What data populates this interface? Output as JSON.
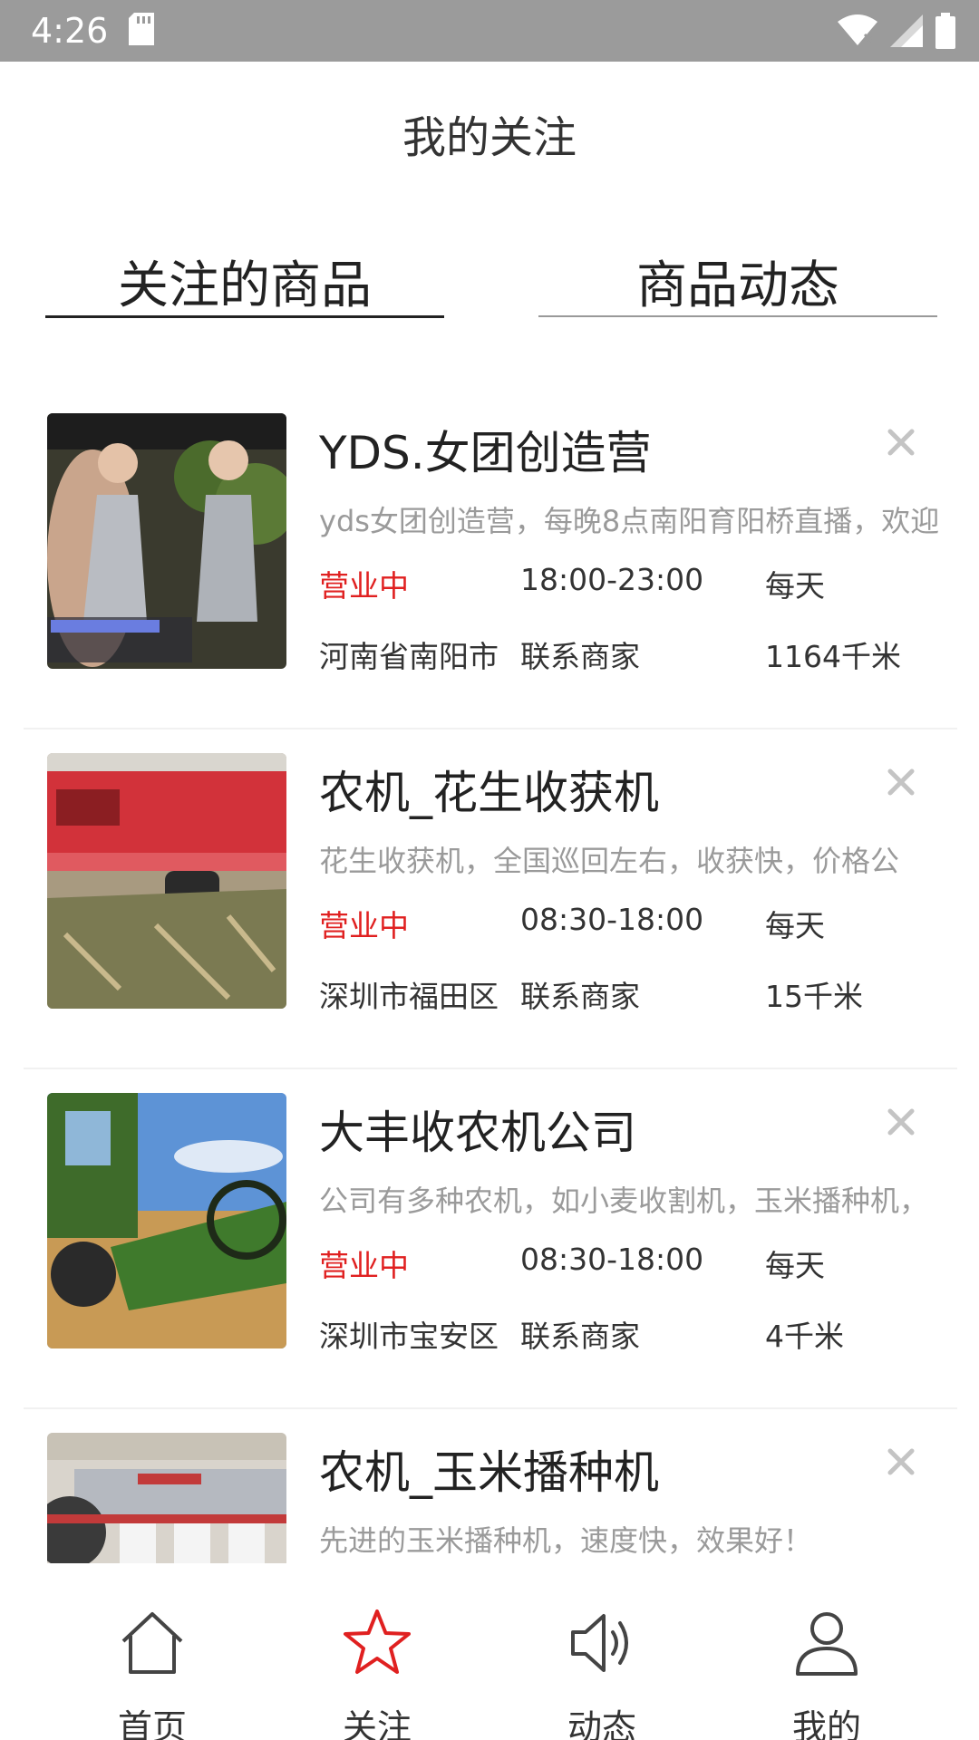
{
  "status_bar": {
    "time": "4:26"
  },
  "header": {
    "title": "我的关注"
  },
  "tabs": [
    {
      "label": "关注的商品",
      "active": true
    },
    {
      "label": "商品动态",
      "active": false
    }
  ],
  "items": [
    {
      "title": "YDS.女团创造营",
      "description": "yds女团创造营，每晚8点南阳育阳桥直播，欢迎",
      "status": "营业中",
      "hours": "18:00-23:00",
      "days": "每天",
      "location": "河南省南阳市",
      "contact": "联系商家",
      "distance": "1164千米"
    },
    {
      "title": "农机_花生收获机",
      "description": "花生收获机，全国巡回左右，收获快，价格公",
      "status": "营业中",
      "hours": "08:30-18:00",
      "days": "每天",
      "location": "深圳市福田区",
      "contact": "联系商家",
      "distance": "15千米"
    },
    {
      "title": "大丰收农机公司",
      "description": "公司有多种农机，如小麦收割机，玉米播种机，",
      "status": "营业中",
      "hours": "08:30-18:00",
      "days": "每天",
      "location": "深圳市宝安区",
      "contact": "联系商家",
      "distance": "4千米"
    },
    {
      "title": "农机_玉米播种机",
      "description": "先进的玉米播种机，速度快，效果好！"
    }
  ],
  "bottom_nav": [
    {
      "label": "首页",
      "icon": "home-icon"
    },
    {
      "label": "关注",
      "icon": "star-icon",
      "active": true
    },
    {
      "label": "动态",
      "icon": "speaker-icon"
    },
    {
      "label": "我的",
      "icon": "user-icon"
    }
  ],
  "colors": {
    "status_open": "#e02020",
    "active_nav": "#e02020",
    "status_bar": "#9b9b9b"
  }
}
